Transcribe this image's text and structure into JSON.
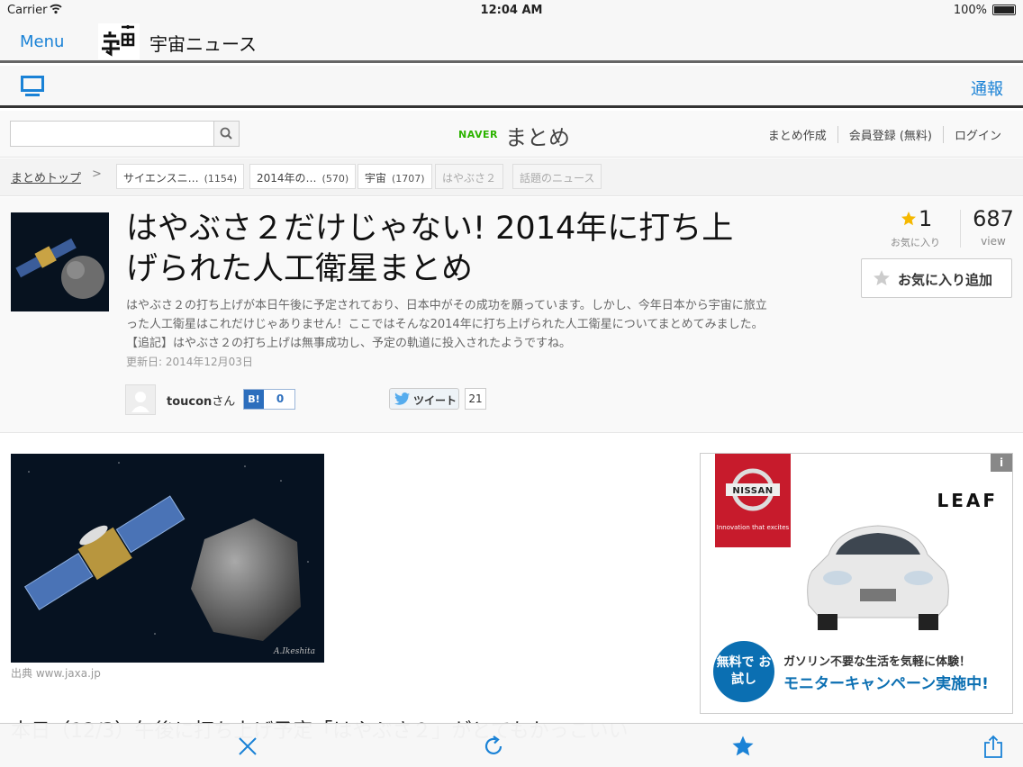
{
  "status_bar": {
    "carrier": "Carrier",
    "time": "12:04 AM",
    "battery": "100%"
  },
  "app_bar": {
    "menu_label": "Menu",
    "title": "宇宙ニュース"
  },
  "sub_bar": {
    "report_label": "通報"
  },
  "site_header": {
    "search_placeholder": "",
    "naver_label": "NAVER",
    "matome_label": "まとめ",
    "links": [
      "まとめ作成",
      "会員登録 (無料)",
      "ログイン"
    ]
  },
  "breadcrumb": {
    "top_label": "まとめトップ",
    "separator": ">",
    "tags": [
      {
        "label": "サイエンスニ…",
        "count": "(1154)"
      },
      {
        "label": "2014年の…",
        "count": "(570)"
      },
      {
        "label": "宇宙",
        "count": "(1707)"
      },
      {
        "label": "はやぶさ２",
        "count": ""
      },
      {
        "label": "話題のニュース",
        "count": ""
      }
    ]
  },
  "article": {
    "title": "はやぶさ２だけじゃない! 2014年に打ち上げられた人工衛星まとめ",
    "description": "はやぶさ２の打ち上げが本日午後に予定されており、日本中がその成功を願っています。しかし、今年日本から宇宙に旅立った人工衛星はこれだけじゃありません！ここではそんな2014年に打ち上げられた人工衛星についてまとめてみました。【追記】はやぶさ２の打ち上げは無事成功し、予定の軌道に投入されたようですね。",
    "updated": "更新日: 2014年12月03日",
    "author_name": "toucon",
    "author_suffix": "さん",
    "hatena_label": "B!",
    "hatena_count": "0",
    "tweet_label": "ツイート",
    "tweet_count": "21",
    "favorites_count": "1",
    "favorites_label": "お気に入り",
    "views_count": "687",
    "views_label": "view",
    "fav_button_label": "お気に入り追加"
  },
  "content": {
    "image_credit": "出典 www.jaxa.jp",
    "partial_heading": "本日（12/3）午後に打ち上げ予定「はやぶさ２」がとてもかっこいい"
  },
  "ad": {
    "info": "i",
    "brand": "NISSAN",
    "tagline": "Innovation that excites",
    "product": "LEAF",
    "badge": "無料で お試し",
    "line1": "ガソリン不要な生活を気軽に体験！",
    "line2": "モニターキャンペーン実施中!"
  },
  "colors": {
    "link_blue": "#1a82d6",
    "naver_green": "#2db400",
    "nissan_red": "#c71b2c",
    "star_gold": "#f5b800"
  },
  "icons": [
    "wifi-icon",
    "monitor-icon",
    "search-icon",
    "star-icon",
    "twitter-icon",
    "close-icon",
    "reload-icon",
    "bookmark-star-icon",
    "share-icon"
  ]
}
